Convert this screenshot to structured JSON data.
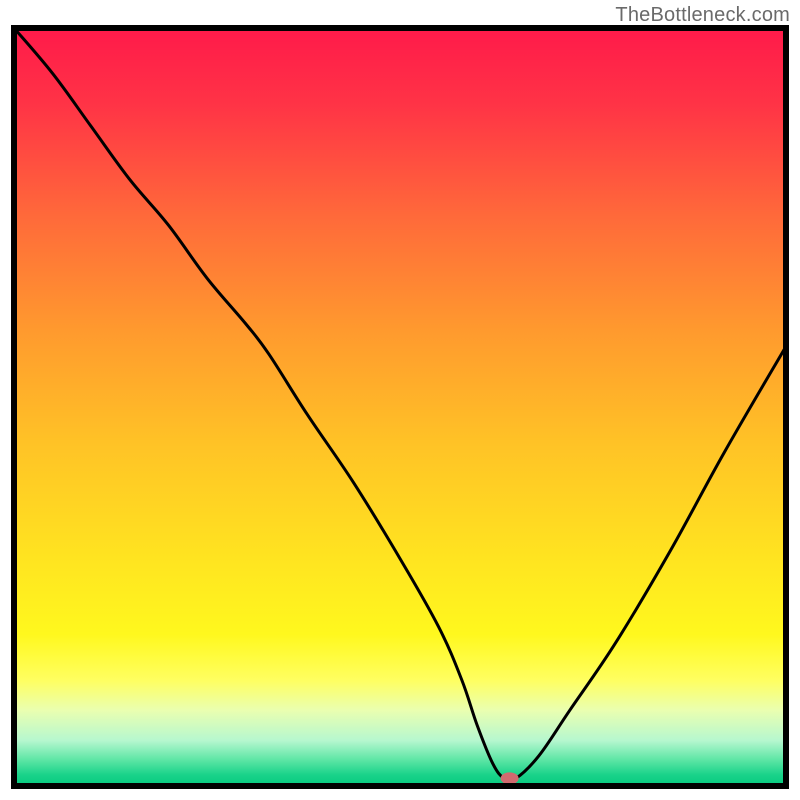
{
  "watermark": "TheBottleneck.com",
  "chart_data": {
    "type": "line",
    "title": "",
    "xlabel": "",
    "ylabel": "",
    "xlim": [
      0,
      100
    ],
    "ylim": [
      0,
      100
    ],
    "grid": false,
    "legend": false,
    "gradient_stops": [
      {
        "offset": 0.0,
        "color": "#ff1a4a"
      },
      {
        "offset": 0.1,
        "color": "#ff3346"
      },
      {
        "offset": 0.25,
        "color": "#ff6a3a"
      },
      {
        "offset": 0.4,
        "color": "#ff9a2e"
      },
      {
        "offset": 0.55,
        "color": "#ffc326"
      },
      {
        "offset": 0.7,
        "color": "#ffe420"
      },
      {
        "offset": 0.8,
        "color": "#fff81e"
      },
      {
        "offset": 0.86,
        "color": "#ffff60"
      },
      {
        "offset": 0.9,
        "color": "#eaffb0"
      },
      {
        "offset": 0.94,
        "color": "#b6f7cf"
      },
      {
        "offset": 0.965,
        "color": "#5fe6a6"
      },
      {
        "offset": 0.985,
        "color": "#1ad38a"
      },
      {
        "offset": 1.0,
        "color": "#05c97f"
      }
    ],
    "series": [
      {
        "name": "bottleneck-curve",
        "x": [
          0,
          5,
          10,
          15,
          20,
          25,
          30,
          33,
          38,
          44,
          50,
          55,
          58,
          60,
          62,
          63.5,
          65,
          68,
          72,
          78,
          85,
          92,
          100
        ],
        "y": [
          100,
          94,
          87,
          80,
          74,
          67,
          61,
          57,
          49,
          40,
          30,
          21,
          14,
          8,
          3,
          1.0,
          1.0,
          4,
          10,
          19,
          31,
          44,
          58
        ]
      }
    ],
    "marker": {
      "x": 64.2,
      "y": 1.0,
      "color": "#d16a6f",
      "rx": 9,
      "ry": 6
    }
  }
}
